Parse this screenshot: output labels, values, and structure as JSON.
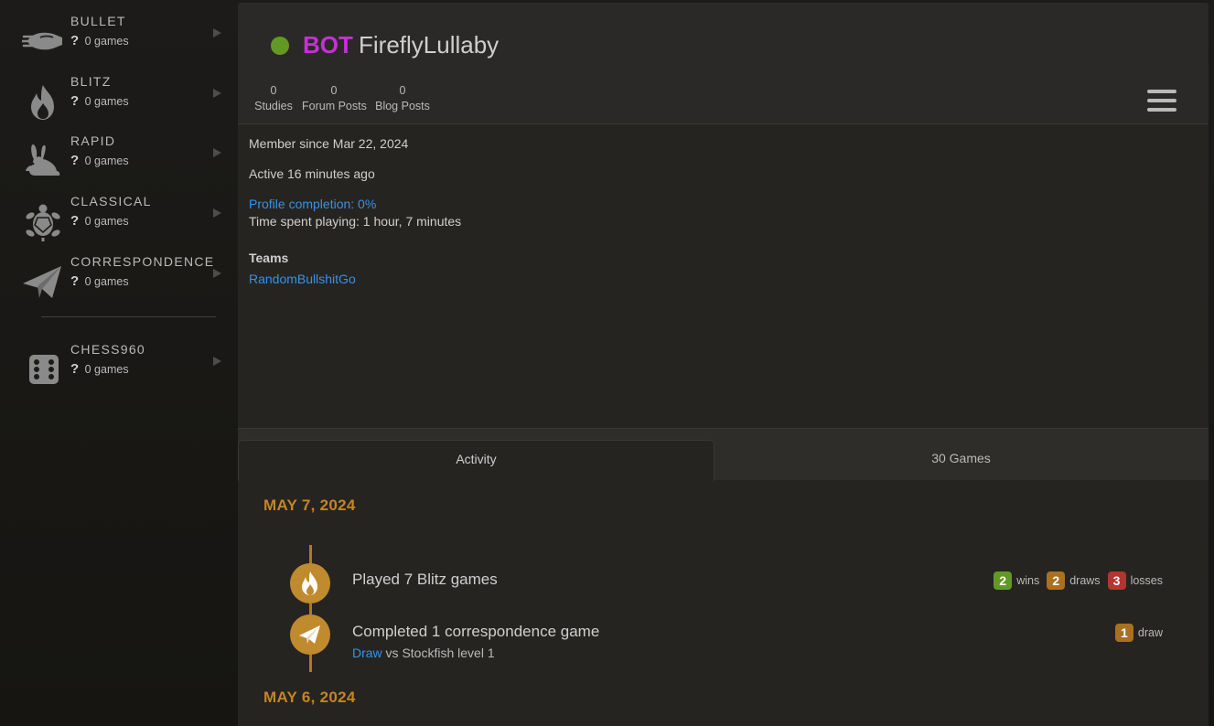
{
  "sidebar": {
    "perfs": [
      {
        "name": "BULLET",
        "rating": "?",
        "games": "0 games",
        "icon": "bullet-icon"
      },
      {
        "name": "BLITZ",
        "rating": "?",
        "games": "0 games",
        "icon": "fire-icon"
      },
      {
        "name": "RAPID",
        "rating": "?",
        "games": "0 games",
        "icon": "rabbit-icon"
      },
      {
        "name": "CLASSICAL",
        "rating": "?",
        "games": "0 games",
        "icon": "turtle-icon"
      },
      {
        "name": "CORRESPONDENCE",
        "rating": "?",
        "games": "0 games",
        "icon": "paper-plane-icon"
      },
      {
        "name": "CHESS960",
        "rating": "?",
        "games": "0 games",
        "icon": "dice-icon"
      }
    ]
  },
  "header": {
    "online_color": "#629924",
    "title_prefix": "BOT",
    "username": "FireflyLullaby",
    "stats": [
      {
        "value": "0",
        "label": "Studies"
      },
      {
        "value": "0",
        "label": "Forum Posts"
      },
      {
        "value": "0",
        "label": "Blog Posts"
      }
    ]
  },
  "info": {
    "member_since": "Member since Mar 22, 2024",
    "active": "Active 16 minutes ago",
    "profile_completion": "Profile completion: 0%",
    "time_spent": "Time spent playing: 1 hour, 7 minutes",
    "teams_heading": "Teams",
    "team": "RandomBullshitGo"
  },
  "tabs": [
    {
      "label": "Activity",
      "active": true
    },
    {
      "label": "30 Games",
      "active": false
    }
  ],
  "activity": {
    "days": [
      {
        "date": "MAY 7, 2024",
        "entries": [
          {
            "icon": "fire-icon",
            "text": "Played 7 Blitz games",
            "score": {
              "wins": "2",
              "wins_label": "wins",
              "draws": "2",
              "draws_label": "draws",
              "losses": "3",
              "losses_label": "losses"
            }
          },
          {
            "icon": "paper-plane-icon",
            "text": "Completed 1 correspondence game",
            "sub_link": "Draw",
            "sub_rest": " vs Stockfish level 1",
            "score": {
              "draws": "1",
              "draws_label": "draw"
            }
          }
        ]
      },
      {
        "date": "MAY 6, 2024"
      }
    ]
  },
  "colors": {
    "bot": "#c630d7",
    "link": "#3692e7",
    "date": "#c48525",
    "win": "#629924",
    "draw": "#a87020",
    "loss": "#b33430"
  }
}
